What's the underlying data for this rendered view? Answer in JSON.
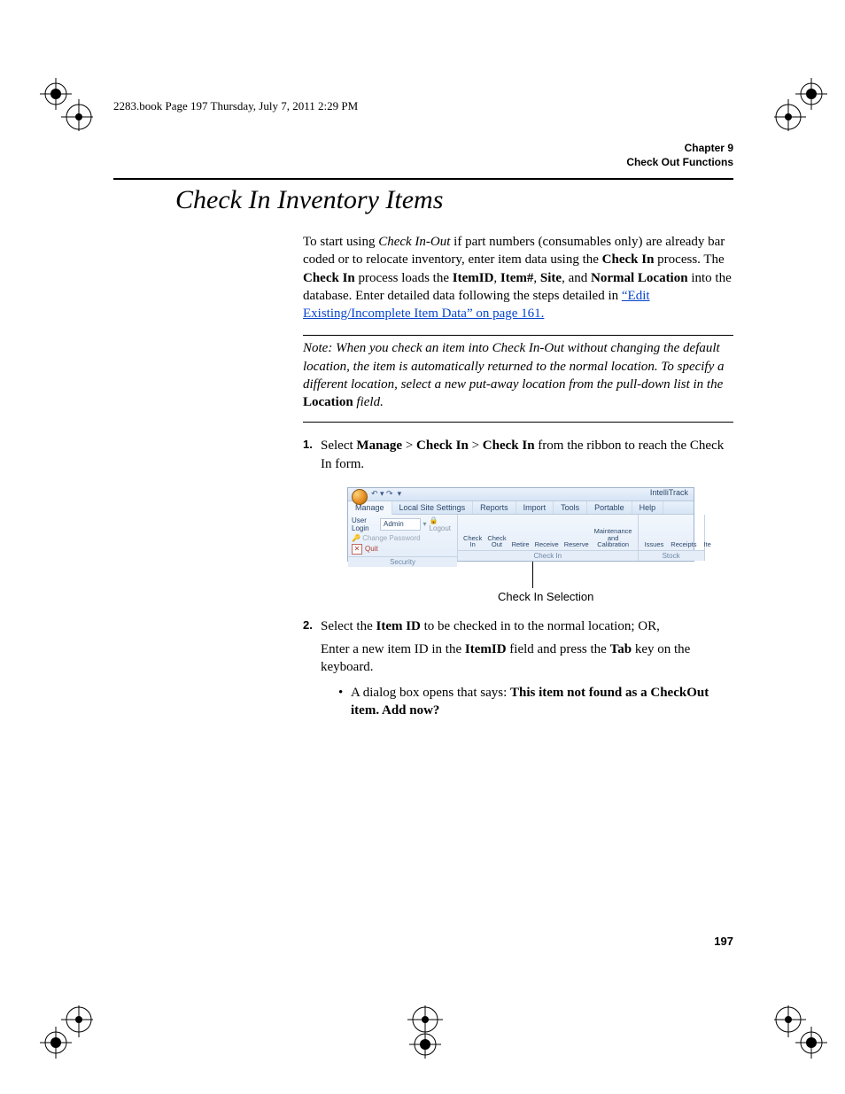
{
  "crop_text": "2283.book  Page 197  Thursday, July 7, 2011  2:29 PM",
  "running_head": {
    "chapter": "Chapter 9",
    "title": "Check Out Functions"
  },
  "section_title": "Check In Inventory Items",
  "intro": {
    "p1_a": "To start using ",
    "p1_i1": "Check In-Out",
    "p1_b": " if part numbers (consumables only) are already bar coded or to relocate inventory, enter item data using the ",
    "p1_bold1": "Check In",
    "p1_c": " process. The ",
    "p1_bold2": "Check In",
    "p1_d": " process loads the ",
    "p1_bold3": "ItemID",
    "p1_e": ", ",
    "p1_bold4": "Item#",
    "p1_f": ", ",
    "p1_bold5": "Site",
    "p1_g": ", and ",
    "p1_bold6": "Nor­mal Location",
    "p1_h": " into the database. Enter detailed data following the steps detailed in ",
    "p1_link": "“Edit Existing/Incomplete Item Data” on page 161."
  },
  "note": {
    "label": "Note:   ",
    "body_a": "When you check an item into Check In-Out without changing the default location, the item is automatically returned to the normal location. To specify a different location, select a new put-away location from the pull-down list in the ",
    "loc": "Location",
    "body_b": " field."
  },
  "step1": {
    "num": "1.",
    "a": "Select ",
    "b1": "Manage ",
    "gt1": " > ",
    "b2": "Check In ",
    "gt2": " > ",
    "b3": "Check In",
    "b": " from the ribbon to reach the Check In form."
  },
  "ribbon": {
    "app_title": "IntelliTrack",
    "tabs": {
      "manage": "Manage",
      "local": "Local Site Settings",
      "reports": "Reports",
      "import": "Import",
      "tools": "Tools",
      "portable": "Portable",
      "help": "Help"
    },
    "security": {
      "user_login_label": "User Login",
      "user_login_value": "Admin",
      "logout": "Logout",
      "change_pw": "Change Password",
      "quit": "Quit",
      "group_label": "Security"
    },
    "checkin": {
      "btn_checkin": "Check\nIn",
      "btn_checkout": "Check\nOut",
      "btn_retire": "Retire",
      "btn_receive": "Receive",
      "btn_reserve": "Reserve",
      "btn_maint": "Maintenance\nand Calibration",
      "group_label": "Check In"
    },
    "stock": {
      "btn_issues": "Issues",
      "btn_receipts": "Receipts",
      "btn_ite": "Ite",
      "group_label": "Stock"
    }
  },
  "pointer_caption": "Check In Selection",
  "step2": {
    "num": "2.",
    "a": "Select the ",
    "b1": "Item ID",
    "b": " to be checked in to the normal location; OR,",
    "p2_a": "Enter a new item ID in the ",
    "p2_b1": "ItemID",
    "p2_b": " field and press the ",
    "p2_b2": "Tab",
    "p2_c": " key on the keyboard.",
    "bullet_a": "A dialog box opens that says: ",
    "bullet_b": "This item not found as a CheckOut item. Add now?"
  },
  "page_no": "197"
}
